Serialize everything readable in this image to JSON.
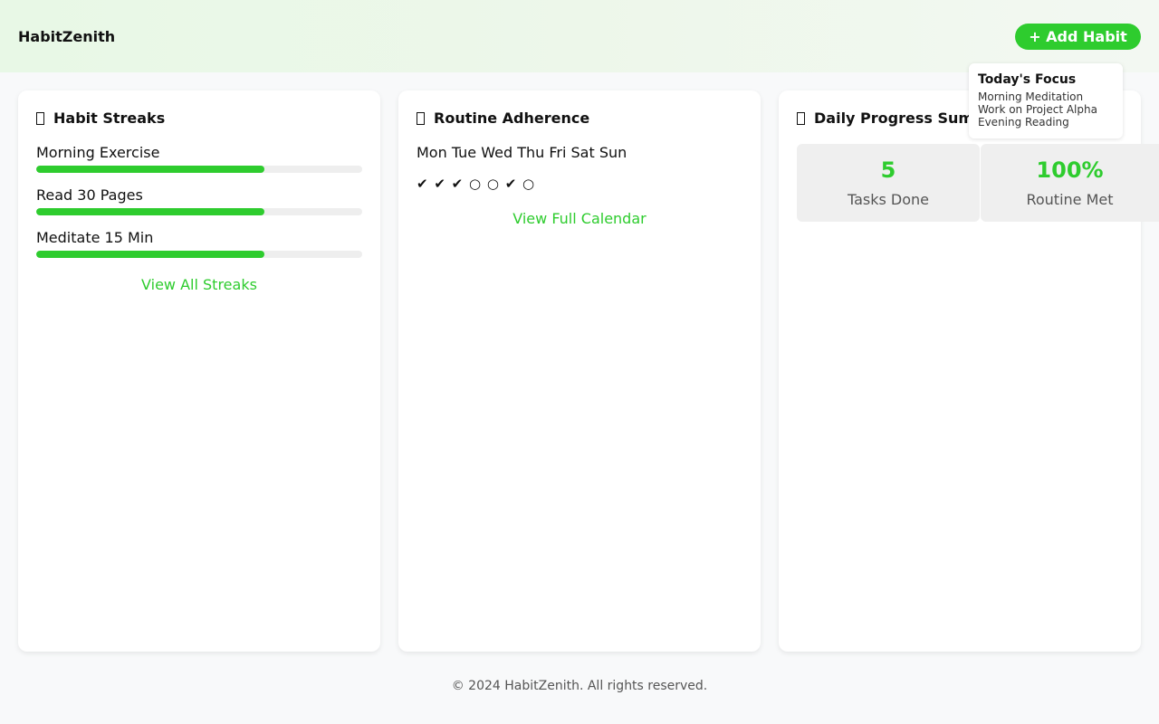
{
  "header": {
    "brand": "HabitZenith",
    "add_button": "+ Add Habit"
  },
  "colors": {
    "accent": "#2ecc2e",
    "background": "#f8f9fa",
    "track": "#eeeeee"
  },
  "streaks": {
    "icon": "chart-icon",
    "title": "Habit Streaks",
    "habits": [
      {
        "label": "Morning Exercise",
        "progress": 0.7
      },
      {
        "label": "Read 30 Pages",
        "progress": 0.7
      },
      {
        "label": "Meditate 15 Min",
        "progress": 0.7
      }
    ],
    "link": "View All Streaks"
  },
  "adherence": {
    "icon": "calendar-icon",
    "title": "Routine Adherence",
    "days": "Mon Tue Wed Thu Fri Sat Sun",
    "marks": "✔ ✔ ✔ ○ ○ ✔ ○",
    "link": "View Full Calendar"
  },
  "progress": {
    "icon": "summary-icon",
    "title": "Daily Progress Summary",
    "stats": [
      {
        "value": "5",
        "label": "Tasks Done"
      },
      {
        "value": "100%",
        "label": "Routine Met"
      }
    ]
  },
  "focus": {
    "title": "Today's Focus",
    "items": [
      "Morning Meditation",
      "Work on Project Alpha",
      "Evening Reading"
    ]
  },
  "footer": {
    "text": "© 2024 HabitZenith. All rights reserved."
  }
}
